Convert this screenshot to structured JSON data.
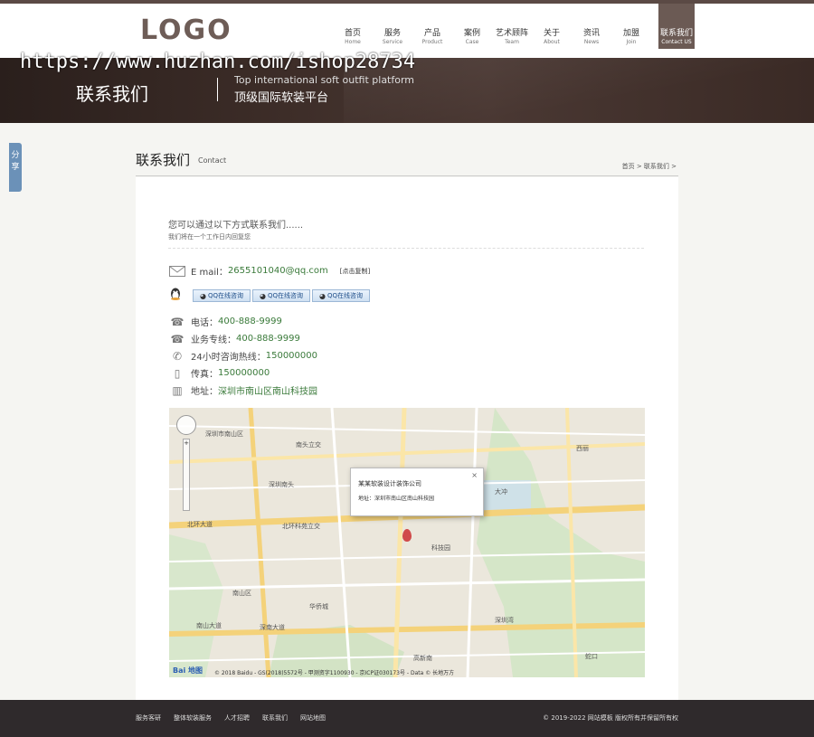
{
  "watermark": "https://www.huzhan.com/ishop28734",
  "header": {
    "logo": "LOGO",
    "nav": [
      {
        "cn": "首页",
        "en": "Home"
      },
      {
        "cn": "服务",
        "en": "Service"
      },
      {
        "cn": "产品",
        "en": "Product"
      },
      {
        "cn": "案例",
        "en": "Case"
      },
      {
        "cn": "艺术顾阵",
        "en": "Team"
      },
      {
        "cn": "关于",
        "en": "About"
      },
      {
        "cn": "资讯",
        "en": "News"
      },
      {
        "cn": "加盟",
        "en": "Join"
      },
      {
        "cn": "联系我们",
        "en": "Contact US"
      }
    ]
  },
  "banner": {
    "title": "联系我们",
    "en": "Top international soft outfit platform",
    "cn": "顶级国际软装平台"
  },
  "share": "分享",
  "page": {
    "title": "联系我们",
    "title_en": "Contact",
    "breadcrumb": "首页 > 联系我们 >"
  },
  "contact": {
    "intro": "您可以通过以下方式联系我们......",
    "intro_sub": "我们将在一个工作日内回复您",
    "email_label": "E mail：",
    "email": "2655101040@qq.com",
    "copy_btn": "[点击复制]",
    "qq_btn": "QQ在线咨询",
    "phone_label": "电话：",
    "phone": "400-888-9999",
    "hotline_label": "业务专线：",
    "hotline": "400-888-9999",
    "support_label": "24小时咨询热线：",
    "support": "150000000",
    "fax_label": "传真：",
    "fax": "150000000",
    "address_label": "地址：",
    "address": "深圳市南山区南山科技园"
  },
  "map": {
    "popup_title": "某某软装设计装饰公司",
    "popup_addr": "地址：深圳市南山区南山科技园",
    "close": "×",
    "brand": "Bai 地图",
    "copyright": "© 2018 Baidu - GS(2018)5572号 - 甲测资字1100930 - 京ICP证030173号 - Data © 长地万方",
    "labels": [
      "深圳市南山区",
      "南头立交",
      "深圳南头",
      "北环大道",
      "科技园",
      "大冲",
      "南山区",
      "华侨城",
      "深圳湾",
      "南山大道",
      "深南大道",
      "高新南",
      "北环科苑立交",
      "蛇口",
      "西丽"
    ]
  },
  "footer": {
    "links": [
      "服务客研",
      "整体软装服务",
      "人才招聘",
      "联系我们",
      "网站地图"
    ],
    "copyright": "© 2019-2022 网站模板 版权所有并保留所有权"
  },
  "colors": {
    "accent": "#6b5a54",
    "banner": "#3d2d28",
    "link": "#3a7a3a",
    "footer": "#2f2a2c"
  }
}
